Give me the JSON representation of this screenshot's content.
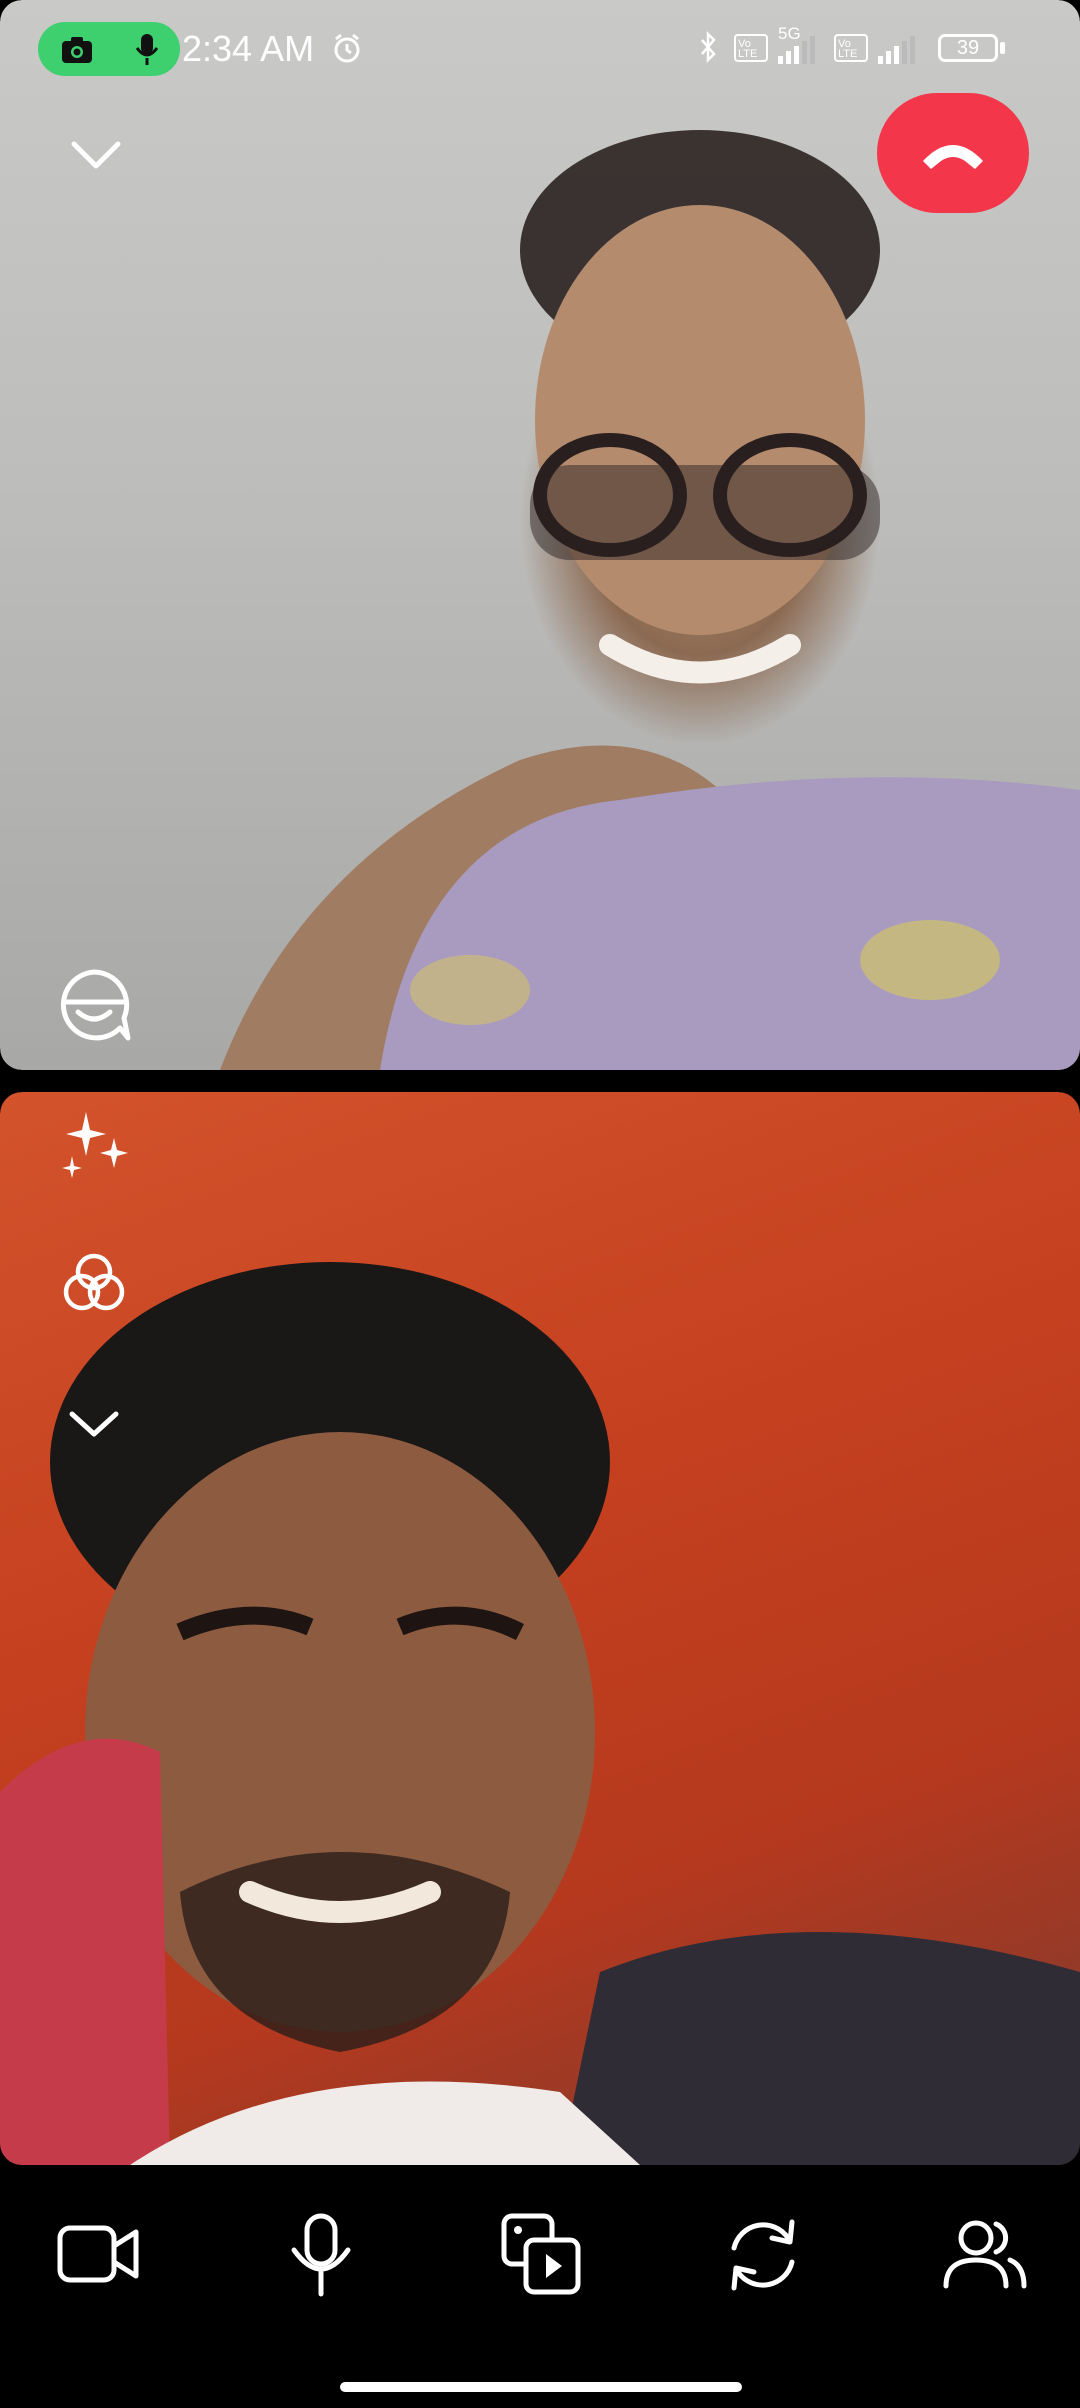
{
  "status_bar": {
    "time": "2:34 AM",
    "network": "5G",
    "volte_1": "Vo LTE",
    "volte_2": "Vo LTE",
    "battery": "39"
  },
  "call": {
    "remote_participant_video": "remote-video",
    "local_participant_video": "self-view"
  },
  "controls": {
    "collapse": "chevron-down-icon",
    "end_call": "phone-hangup-icon",
    "effects": "sparkles-icon",
    "filters": "filters-icon",
    "more_effects": "chevron-down-icon",
    "reaction": "face-bubble-icon",
    "bottom": [
      "video-camera-icon",
      "microphone-icon",
      "share-media-icon",
      "switch-camera-icon",
      "participants-icon"
    ]
  },
  "colors": {
    "end_call": "#f4364a",
    "recording_pill": "#3ecf6e"
  }
}
